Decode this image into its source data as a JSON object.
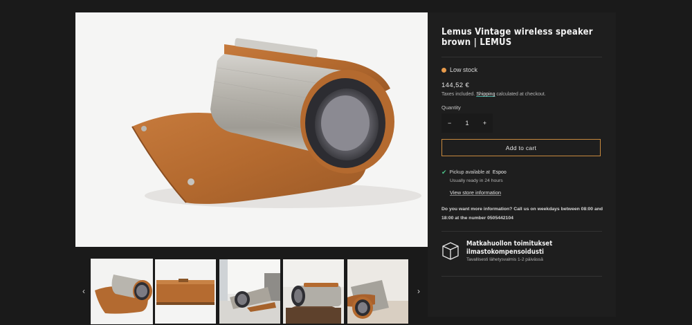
{
  "product": {
    "title": "Lemus Vintage wireless speaker brown | LEMUS",
    "stock_status": "Low stock",
    "stock_color": "#e79a4b",
    "price": "144,52 €",
    "taxes_prefix": "Taxes included.",
    "taxes_link": "Shipping",
    "taxes_suffix": "calculated at checkout.",
    "quantity_label": "Quantity",
    "quantity_value": "1",
    "decrement": "−",
    "increment": "+",
    "add_to_cart": "Add to cart",
    "accent_color": "#c98a3e"
  },
  "pickup": {
    "prefix": "Pickup available at",
    "location": "Espoo",
    "ready": "Usually ready in 24 hours",
    "store_link": "View store information"
  },
  "contact": {
    "text": "Do you want more information? Call us on weekdays between 08:00 and 18:00 at the number 0505442104"
  },
  "delivery": {
    "icon": "box-icon",
    "title": "Matkahuollon toimitukset ilmastokompensoidusti",
    "subtitle": "Tavallisesti lähetysvalmis 1-2 päivässä"
  },
  "gallery": {
    "prev": "‹",
    "next": "›",
    "thumbnail_count": 5,
    "active_index": 0
  }
}
